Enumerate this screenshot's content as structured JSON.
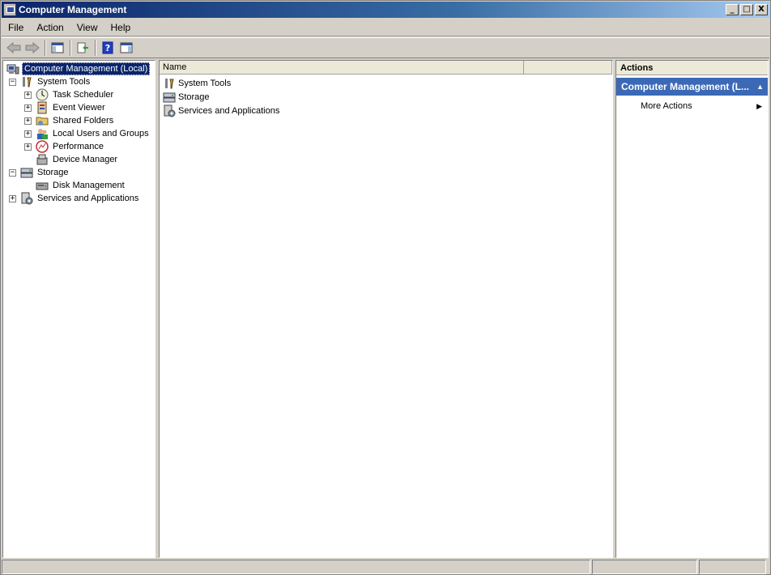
{
  "window": {
    "title": "Computer Management",
    "minimize": "_",
    "maximize": "□",
    "close": "X"
  },
  "menu": {
    "file": "File",
    "action": "Action",
    "view": "View",
    "help": "Help"
  },
  "toolbar": {
    "back": "arrow-left-icon",
    "forward": "arrow-right-icon",
    "show_hide_tree": "console-tree-icon",
    "export": "export-list-icon",
    "help": "help-icon",
    "show_hide_action": "action-pane-icon"
  },
  "tree": {
    "root": "Computer Management (Local)",
    "system_tools": "System Tools",
    "task_scheduler": "Task Scheduler",
    "event_viewer": "Event Viewer",
    "shared_folders": "Shared Folders",
    "local_users": "Local Users and Groups",
    "performance": "Performance",
    "device_manager": "Device Manager",
    "storage": "Storage",
    "disk_management": "Disk Management",
    "services": "Services and Applications",
    "expand_glyph": "+",
    "collapse_glyph": "−"
  },
  "list": {
    "columns": [
      "Name",
      ""
    ],
    "rows": [
      "System Tools",
      "Storage",
      "Services and Applications"
    ]
  },
  "actions": {
    "header": "Actions",
    "section": "Computer Management (L...",
    "section_glyph": "▲",
    "more_actions": "More Actions",
    "more_glyph": "▶"
  },
  "colors": {
    "selection": "#0a246a",
    "actions_section": "#3c69b6"
  }
}
